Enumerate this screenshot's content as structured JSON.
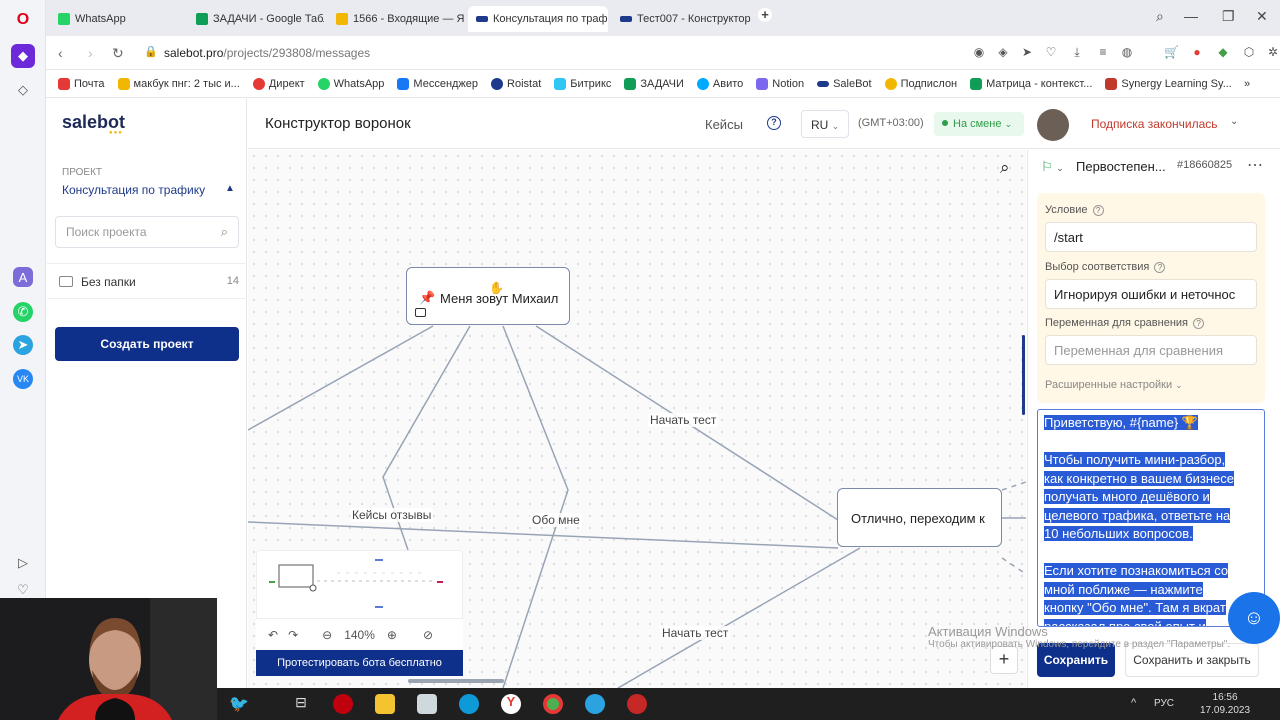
{
  "browser": {
    "tabs": [
      {
        "label": "WhatsApp",
        "color": "#25d366"
      },
      {
        "label": "ЗАДАЧИ - Google Табли",
        "color": "#0f9d58"
      },
      {
        "label": "1566 - Входящие — Янде",
        "color": "#f2b705"
      },
      {
        "label": "Консультация по трафик",
        "color": "#1e3a8a",
        "active": true
      },
      {
        "label": "Тест007 - Конструктор в",
        "color": "#1e3a8a"
      }
    ],
    "new_tab": "+",
    "url_host": "salebot.pro",
    "url_path": "/projects/293808/messages",
    "bookmarks": [
      {
        "label": "Почта",
        "color": "#e53935"
      },
      {
        "label": "макбук пнг: 2 тыс и...",
        "color": "#f2b705"
      },
      {
        "label": "Директ",
        "color": "#e53935"
      },
      {
        "label": "WhatsApp",
        "color": "#25d366"
      },
      {
        "label": "Мессенджер",
        "color": "#1877f2"
      },
      {
        "label": "Roistat",
        "color": "#1e3a8a"
      },
      {
        "label": "Битрикс",
        "color": "#2fc6f6"
      },
      {
        "label": "ЗАДАЧИ",
        "color": "#0f9d58"
      },
      {
        "label": "Авито",
        "color": "#00aaff"
      },
      {
        "label": "Notion",
        "color": "#7b68ee"
      },
      {
        "label": "SaleBot",
        "color": "#1e3a8a"
      },
      {
        "label": "Подпислон",
        "color": "#f2b705"
      },
      {
        "label": "Матрица - контекст...",
        "color": "#0f9d58"
      },
      {
        "label": "Synergy Learning Sy...",
        "color": "#c0392b"
      }
    ],
    "bookmarks_more": "»"
  },
  "sidebar": {
    "logo": "salebot",
    "logo_dots": "●●●",
    "project_label": "ПРОЕКТ",
    "project_name": "Консультация по трафику",
    "search_placeholder": "Поиск проекта",
    "folder_name": "Без папки",
    "folder_count": "14",
    "create_button": "Создать проект"
  },
  "header": {
    "title": "Конструктор воронок",
    "cases": "Кейсы",
    "help": "?",
    "lang": "RU",
    "timezone": "(GMT+03:00)",
    "shift_status": "На смене",
    "subscription": "Подписка закончилась"
  },
  "canvas": {
    "nodes": [
      {
        "label": "Меня зовут Михаил"
      },
      {
        "label": "Отлично, переходим к"
      }
    ],
    "edge_labels": [
      "Начать тест",
      "Кейсы отзывы",
      "Обо мне",
      "Начать тест"
    ],
    "zoom": "140%",
    "test_bot_button": "Протестировать бота бесплатно"
  },
  "panel": {
    "title": "Первостепен...",
    "block_id": "#18660825",
    "condition_label": "Условие",
    "condition_value": "/start",
    "match_label": "Выбор соответствия",
    "match_value": "Игнорируя ошибки и неточнос",
    "compare_label": "Переменная для сравнения",
    "compare_placeholder": "Переменная для сравнения",
    "advanced": "Расширенные настройки",
    "message_lines": [
      "Приветствую, #{name} 🏆",
      "",
      "Чтобы получить мини-разбор,",
      "как конкретно в вашем бизнесе",
      "получать много дешёвого и",
      "целевого трафика, ответьте на",
      "10 небольших вопросов.",
      "",
      "Если хотите познакомиться со",
      "мной поближе — нажмите",
      "кнопку \"Обо мне\". Там я вкрат",
      "рассказал про свой опыт и"
    ],
    "save": "Сохранить",
    "save_close": "Сохранить и закрыть"
  },
  "watermark": {
    "title": "Активация Windows",
    "subtitle": "Чтобы активировать Windows, перейдите в раздел \"Параметры\"."
  },
  "taskbar": {
    "lang": "РУС",
    "time": "16:56",
    "date": "17.09.2023"
  }
}
